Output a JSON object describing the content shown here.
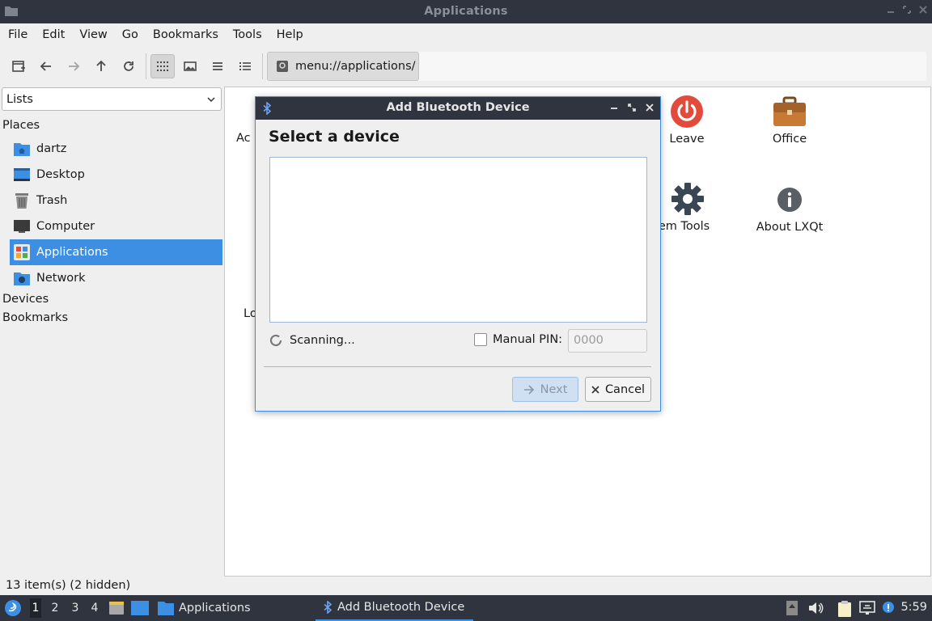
{
  "window": {
    "title": "Applications"
  },
  "menu": [
    "File",
    "Edit",
    "View",
    "Go",
    "Bookmarks",
    "Tools",
    "Help"
  ],
  "toolbar": {
    "path": "menu://applications/",
    "buttons": [
      "new-window-icon",
      "back-icon",
      "forward-icon",
      "up-icon",
      "reload-icon",
      "icon-view-icon",
      "thumbnail-view-icon",
      "compact-view-icon",
      "detailed-list-view-icon"
    ]
  },
  "sidebar": {
    "mode": "Lists",
    "places_label": "Places",
    "items": [
      {
        "label": "dartz",
        "icon": "home-folder-icon"
      },
      {
        "label": "Desktop",
        "icon": "desktop-icon"
      },
      {
        "label": "Trash",
        "icon": "trash-icon"
      },
      {
        "label": "Computer",
        "icon": "computer-icon"
      },
      {
        "label": "Applications",
        "icon": "applications-icon",
        "selected": true
      },
      {
        "label": "Network",
        "icon": "network-icon"
      }
    ],
    "devices_label": "Devices",
    "bookmarks_label": "Bookmarks"
  },
  "content": {
    "items": [
      {
        "label": "Ac",
        "icon": ""
      },
      {
        "label": "Leave",
        "icon": "power-icon"
      },
      {
        "label": "Office",
        "icon": "briefcase-icon"
      },
      {
        "label": "ystem Tools",
        "icon": "gear-icon"
      },
      {
        "label": "About LXQt",
        "icon": "info-icon"
      },
      {
        "label": "Lo",
        "icon": ""
      }
    ]
  },
  "status": "13 item(s) (2 hidden)",
  "dialog": {
    "title": "Add Bluetooth Device",
    "heading": "Select a device",
    "scanning": "Scanning...",
    "manual_pin_label": "Manual PIN:",
    "pin_placeholder": "0000",
    "next_label": "Next",
    "cancel_label": "Cancel"
  },
  "taskbar": {
    "workspaces": [
      "1",
      "2",
      "3",
      "4"
    ],
    "tasks": [
      {
        "label": "Applications",
        "icon": "folder-icon"
      },
      {
        "label": "Add Bluetooth Device",
        "icon": "bluetooth-icon"
      }
    ],
    "clock": "5:59"
  },
  "colors": {
    "accent": "#3d8fe4",
    "panel": "#2f343f",
    "window_bg": "#efefef"
  }
}
